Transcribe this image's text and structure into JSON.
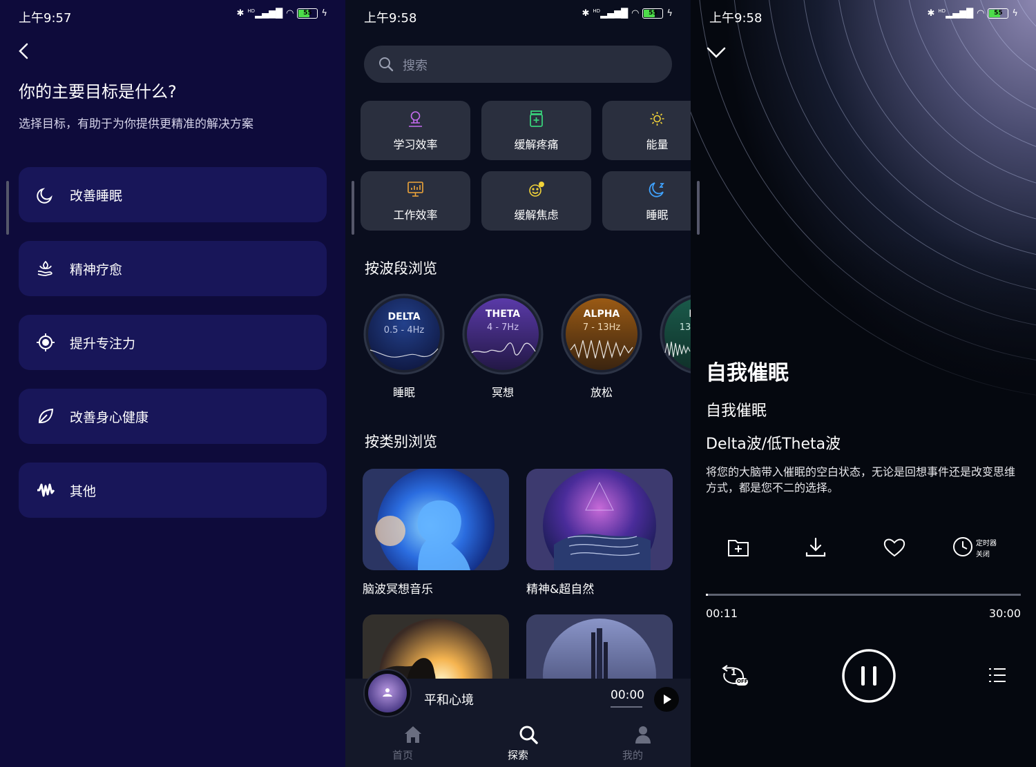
{
  "status": {
    "time_1": "上午9:57",
    "time_2": "上午9:58",
    "time_3": "上午9:58",
    "battery": "55",
    "signal_label": "HD"
  },
  "onboarding": {
    "title": "你的主要目标是什么?",
    "subtitle": "选择目标，有助于为你提供更精准的解决方案",
    "goals": [
      {
        "label": "改善睡眠",
        "icon": "moon-icon"
      },
      {
        "label": "精神疗愈",
        "icon": "lotus-hand-icon"
      },
      {
        "label": "提升专注力",
        "icon": "target-icon"
      },
      {
        "label": "改善身心健康",
        "icon": "leaf-icon"
      },
      {
        "label": "其他",
        "icon": "waveform-icon"
      }
    ]
  },
  "explore": {
    "search_placeholder": "搜索",
    "categories": [
      {
        "label": "学习效率",
        "icon": "study-bulb-icon",
        "color": "#c66cf0"
      },
      {
        "label": "缓解疼痛",
        "icon": "pill-bottle-icon",
        "color": "#39d07a"
      },
      {
        "label": "能量",
        "icon": "sun-icon",
        "color": "#f2d339"
      },
      {
        "label": "工作效率",
        "icon": "monitor-chart-icon",
        "color": "#f0a63a"
      },
      {
        "label": "缓解焦虑",
        "icon": "smile-icon",
        "color": "#f2d339"
      },
      {
        "label": "睡眠",
        "icon": "moon-stars-icon",
        "color": "#3fa3ff"
      }
    ],
    "band_title": "按波段浏览",
    "bands": [
      {
        "name": "DELTA",
        "range": "0.5 - 4Hz",
        "label": "睡眠"
      },
      {
        "name": "THETA",
        "range": "4 - 7Hz",
        "label": "冥想"
      },
      {
        "name": "ALPHA",
        "range": "7 - 13Hz",
        "label": "放松"
      },
      {
        "name": "I",
        "range": "13",
        "label": ""
      }
    ],
    "category_title": "按类别浏览",
    "cards": [
      {
        "label": "脑波冥想音乐"
      },
      {
        "label": "精神&超自然"
      }
    ],
    "mini_player": {
      "title": "平和心境",
      "time": "00:00"
    },
    "nav": [
      {
        "label": "首页",
        "icon": "home-icon"
      },
      {
        "label": "探索",
        "icon": "search-icon"
      },
      {
        "label": "我的",
        "icon": "user-icon"
      }
    ],
    "accent": "#ffffff"
  },
  "player": {
    "title": "自我催眠",
    "subtitle": "自我催眠",
    "band": "Delta波/低Theta波",
    "description": "将您的大脑带入催眠的空白状态，无论是回想事件还是改变思维方式，都是您不二的选择。",
    "timer_label_1": "定时器",
    "timer_label_2": "关闭",
    "elapsed": "00:11",
    "duration": "30:00",
    "progress_fraction": 0.006,
    "repeat_badge": "OFF",
    "repeat_number": "1"
  }
}
